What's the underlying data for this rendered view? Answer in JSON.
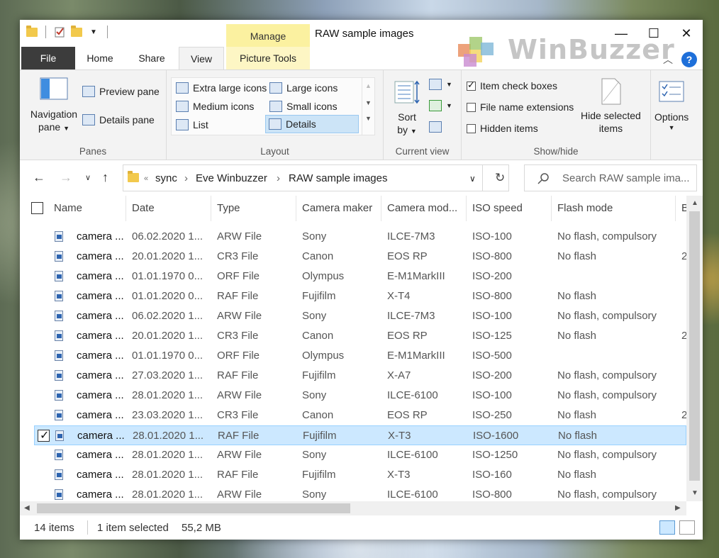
{
  "window": {
    "title": "RAW sample images",
    "context_tab": "Manage",
    "logo_text": "WinBuzzer",
    "controls": {
      "minimize": "—",
      "maximize": "☐",
      "close": "✕"
    }
  },
  "tabs": {
    "file": "File",
    "home": "Home",
    "share": "Share",
    "view": "View",
    "picture_tools": "Picture Tools"
  },
  "ribbon": {
    "panes": {
      "navigation_pane": "Navigation",
      "navigation_pane_2": "pane",
      "preview_pane": "Preview pane",
      "details_pane": "Details pane",
      "label": "Panes"
    },
    "layout": {
      "items": [
        "Extra large icons",
        "Large icons",
        "Medium icons",
        "Small icons",
        "List",
        "Details"
      ],
      "selected": "Details",
      "label": "Layout"
    },
    "current_view": {
      "sort_by": "Sort",
      "sort_by_2": "by",
      "label": "Current view"
    },
    "show_hide": {
      "item_check_boxes": "Item check boxes",
      "item_check_boxes_checked": true,
      "file_name_extensions": "File name extensions",
      "hidden_items": "Hidden items",
      "hide_selected": "Hide selected",
      "hide_selected_2": "items",
      "label": "Show/hide"
    },
    "options": "Options"
  },
  "address": {
    "breadcrumb": [
      "sync",
      "Eve Winbuzzer",
      "RAW sample images"
    ],
    "overflow": "«",
    "search_placeholder": "Search RAW sample ima..."
  },
  "columns": [
    "Name",
    "Date",
    "Type",
    "Camera maker",
    "Camera mod...",
    "ISO speed",
    "Flash mode",
    "B"
  ],
  "rows": [
    {
      "name": "camera ...",
      "date": "06.02.2020 1...",
      "type": "ARW File",
      "maker": "Sony",
      "model": "ILCE-7M3",
      "iso": "ISO-100",
      "flash": "No flash, compulsory",
      "extra": ""
    },
    {
      "name": "camera ...",
      "date": "20.01.2020 1...",
      "type": "CR3 File",
      "maker": "Canon",
      "model": "EOS RP",
      "iso": "ISO-800",
      "flash": "No flash",
      "extra": "2"
    },
    {
      "name": "camera ...",
      "date": "01.01.1970 0...",
      "type": "ORF File",
      "maker": "Olympus",
      "model": "E-M1MarkIII",
      "iso": "ISO-200",
      "flash": "",
      "extra": ""
    },
    {
      "name": "camera ...",
      "date": "01.01.2020 0...",
      "type": "RAF File",
      "maker": "Fujifilm",
      "model": "X-T4",
      "iso": "ISO-800",
      "flash": "No flash",
      "extra": ""
    },
    {
      "name": "camera ...",
      "date": "06.02.2020 1...",
      "type": "ARW File",
      "maker": "Sony",
      "model": "ILCE-7M3",
      "iso": "ISO-100",
      "flash": "No flash, compulsory",
      "extra": ""
    },
    {
      "name": "camera ...",
      "date": "20.01.2020 1...",
      "type": "CR3 File",
      "maker": "Canon",
      "model": "EOS RP",
      "iso": "ISO-125",
      "flash": "No flash",
      "extra": "2"
    },
    {
      "name": "camera ...",
      "date": "01.01.1970 0...",
      "type": "ORF File",
      "maker": "Olympus",
      "model": "E-M1MarkIII",
      "iso": "ISO-500",
      "flash": "",
      "extra": ""
    },
    {
      "name": "camera ...",
      "date": "27.03.2020 1...",
      "type": "RAF File",
      "maker": "Fujifilm",
      "model": "X-A7",
      "iso": "ISO-200",
      "flash": "No flash, compulsory",
      "extra": ""
    },
    {
      "name": "camera ...",
      "date": "28.01.2020 1...",
      "type": "ARW File",
      "maker": "Sony",
      "model": "ILCE-6100",
      "iso": "ISO-100",
      "flash": "No flash, compulsory",
      "extra": ""
    },
    {
      "name": "camera ...",
      "date": "23.03.2020 1...",
      "type": "CR3 File",
      "maker": "Canon",
      "model": "EOS RP",
      "iso": "ISO-250",
      "flash": "No flash",
      "extra": "2"
    },
    {
      "name": "camera ...",
      "date": "28.01.2020 1...",
      "type": "RAF File",
      "maker": "Fujifilm",
      "model": "X-T3",
      "iso": "ISO-1600",
      "flash": "No flash",
      "extra": "",
      "selected": true
    },
    {
      "name": "camera ...",
      "date": "28.01.2020 1...",
      "type": "ARW File",
      "maker": "Sony",
      "model": "ILCE-6100",
      "iso": "ISO-1250",
      "flash": "No flash, compulsory",
      "extra": ""
    },
    {
      "name": "camera ...",
      "date": "28.01.2020 1...",
      "type": "RAF File",
      "maker": "Fujifilm",
      "model": "X-T3",
      "iso": "ISO-160",
      "flash": "No flash",
      "extra": ""
    },
    {
      "name": "camera ...",
      "date": "28.01.2020 1...",
      "type": "ARW File",
      "maker": "Sony",
      "model": "ILCE-6100",
      "iso": "ISO-800",
      "flash": "No flash, compulsory",
      "extra": ""
    }
  ],
  "status": {
    "count": "14 items",
    "selection": "1 item selected",
    "size": "55,2 MB"
  },
  "colors": {
    "accent": "#1e6fd9",
    "selection": "#cce8ff",
    "manage": "#fbf1a0"
  }
}
